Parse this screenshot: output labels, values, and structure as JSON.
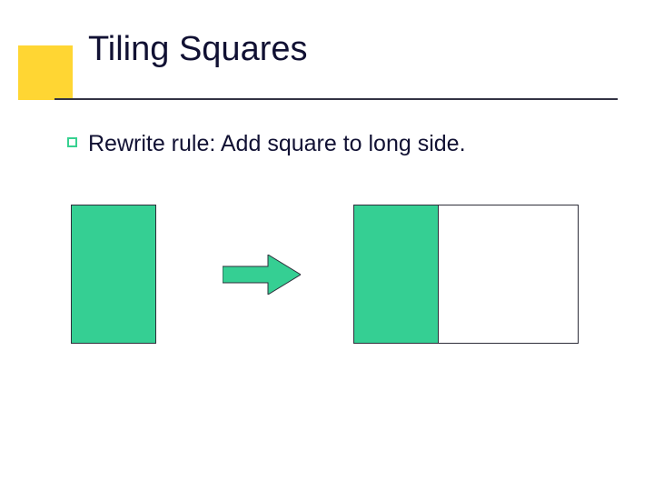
{
  "title": "Tiling Squares",
  "body": "Rewrite rule:  Add square to long side.",
  "colors": {
    "accent_yellow": "#ffd633",
    "shape_green": "#35cf93",
    "text": "#111133",
    "rule": "#333344"
  },
  "diagram": {
    "left_shape": "vertical-rectangle-green",
    "arrow": "right-arrow-green",
    "right_shape": "vertical-rectangle-green-plus-white-square"
  }
}
